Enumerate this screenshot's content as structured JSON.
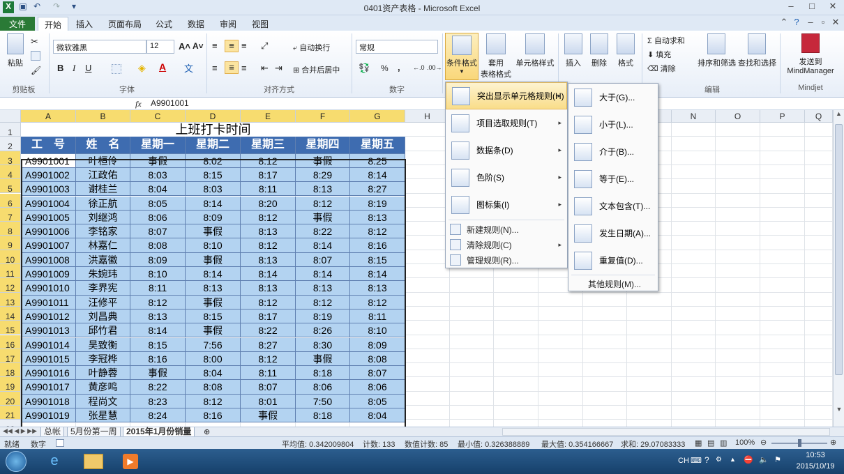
{
  "window": {
    "title": "0401资产表格 - Microsoft Excel",
    "min": "–",
    "max": "□",
    "close": "✕"
  },
  "ribbon_tabs": [
    "文件",
    "开始",
    "插入",
    "页面布局",
    "公式",
    "数据",
    "审阅",
    "视图"
  ],
  "ribbon": {
    "paste": "粘贴",
    "font_name": "微软雅黑",
    "font_size": "12",
    "bold": "B",
    "italic": "I",
    "underline": "U",
    "wrap_text": "自动换行",
    "merge_center": "合并后居中",
    "number_format": "常规",
    "percent": "%",
    "comma": ",",
    "cond_format": "条件格式",
    "table_format_1": "套用",
    "table_format_2": "表格格式",
    "cell_style": "单元格样式",
    "insert": "插入",
    "delete": "删除",
    "format": "格式",
    "autosum": "自动求和",
    "fill": "填充",
    "clear": "清除",
    "sort_filter": "排序和筛选",
    "find_select": "查找和选择",
    "send_to_1": "发送到",
    "send_to_2": "MindManager",
    "groups": {
      "clipboard": "剪贴板",
      "font": "字体",
      "alignment": "对齐方式",
      "number": "数字",
      "editing": "编辑",
      "mindjet": "Mindjet"
    }
  },
  "formula_bar": {
    "name_box": "A3",
    "fx": "fx",
    "content": "A9901001"
  },
  "columns": [
    "A",
    "B",
    "C",
    "D",
    "E",
    "F",
    "G",
    "H",
    "I",
    "J",
    "K",
    "L",
    "M",
    "N",
    "O",
    "P",
    "Q"
  ],
  "sheet": {
    "title": "上班打卡时间",
    "headers": [
      "工　号",
      "姓　名",
      "星期一",
      "星期二",
      "星期三",
      "星期四",
      "星期五"
    ],
    "rows": [
      [
        "A9901001",
        "叶桓伶",
        "事假",
        "8:02",
        "8:12",
        "事假",
        "8:25"
      ],
      [
        "A9901002",
        "江政佑",
        "8:03",
        "8:15",
        "8:17",
        "8:29",
        "8:14"
      ],
      [
        "A9901003",
        "谢桂兰",
        "8:04",
        "8:03",
        "8:11",
        "8:13",
        "8:27"
      ],
      [
        "A9901004",
        "徐正航",
        "8:05",
        "8:14",
        "8:20",
        "8:12",
        "8:19"
      ],
      [
        "A9901005",
        "刘继鸿",
        "8:06",
        "8:09",
        "8:12",
        "事假",
        "8:13"
      ],
      [
        "A9901006",
        "李铭家",
        "8:07",
        "事假",
        "8:13",
        "8:22",
        "8:12"
      ],
      [
        "A9901007",
        "林嘉仁",
        "8:08",
        "8:10",
        "8:12",
        "8:14",
        "8:16"
      ],
      [
        "A9901008",
        "洪嘉徽",
        "8:09",
        "事假",
        "8:13",
        "8:07",
        "8:15"
      ],
      [
        "A9901009",
        "朱婉玮",
        "8:10",
        "8:14",
        "8:14",
        "8:14",
        "8:14"
      ],
      [
        "A9901010",
        "李界宪",
        "8:11",
        "8:13",
        "8:13",
        "8:13",
        "8:13"
      ],
      [
        "A9901011",
        "汪修平",
        "8:12",
        "事假",
        "8:12",
        "8:12",
        "8:12"
      ],
      [
        "A9901012",
        "刘昌典",
        "8:13",
        "8:15",
        "8:17",
        "8:19",
        "8:11"
      ],
      [
        "A9901013",
        "邱竹君",
        "8:14",
        "事假",
        "8:22",
        "8:26",
        "8:10"
      ],
      [
        "A9901014",
        "吴致衡",
        "8:15",
        "7:56",
        "8:27",
        "8:30",
        "8:09"
      ],
      [
        "A9901015",
        "李冠桦",
        "8:16",
        "8:00",
        "8:12",
        "事假",
        "8:08"
      ],
      [
        "A9901016",
        "叶静蓉",
        "事假",
        "8:04",
        "8:11",
        "8:18",
        "8:07"
      ],
      [
        "A9901017",
        "黄彦鸣",
        "8:22",
        "8:08",
        "8:07",
        "8:06",
        "8:06"
      ],
      [
        "A9901018",
        "程尚文",
        "8:23",
        "8:12",
        "8:01",
        "7:50",
        "8:05"
      ],
      [
        "A9901019",
        "张星慧",
        "8:24",
        "8:16",
        "事假",
        "8:18",
        "8:04"
      ]
    ]
  },
  "cond_menu": [
    {
      "label": "突出显示单元格规则(H)",
      "arrow": "▸"
    },
    {
      "label": "项目选取规则(T)",
      "arrow": "▸"
    },
    {
      "label": "数据条(D)",
      "arrow": "▸"
    },
    {
      "label": "色阶(S)",
      "arrow": "▸"
    },
    {
      "label": "图标集(I)",
      "arrow": "▸"
    }
  ],
  "cond_menu_small": [
    {
      "label": "新建规则(N)..."
    },
    {
      "label": "清除规则(C)",
      "arrow": "▸"
    },
    {
      "label": "管理规则(R)..."
    }
  ],
  "sub_menu": [
    "大于(G)...",
    "小于(L)...",
    "介于(B)...",
    "等于(E)...",
    "文本包含(T)...",
    "发生日期(A)...",
    "重复值(D)..."
  ],
  "sub_menu_more": "其他规则(M)...",
  "sheet_tabs": [
    "总帐",
    "5月份第一周",
    "2015年1月份销量"
  ],
  "status": {
    "ready": "就绪",
    "mode": "数字",
    "average": "平均值: 0.342009804",
    "count": "计数: 133",
    "numcount": "数值计数: 85",
    "min": "最小值: 0.326388889",
    "max": "最大值: 0.354166667",
    "sum": "求和: 29.07083333",
    "zoom": "100%"
  },
  "taskbar": {
    "lang": "CH",
    "time": "10:53",
    "date": "2015/10/19"
  }
}
